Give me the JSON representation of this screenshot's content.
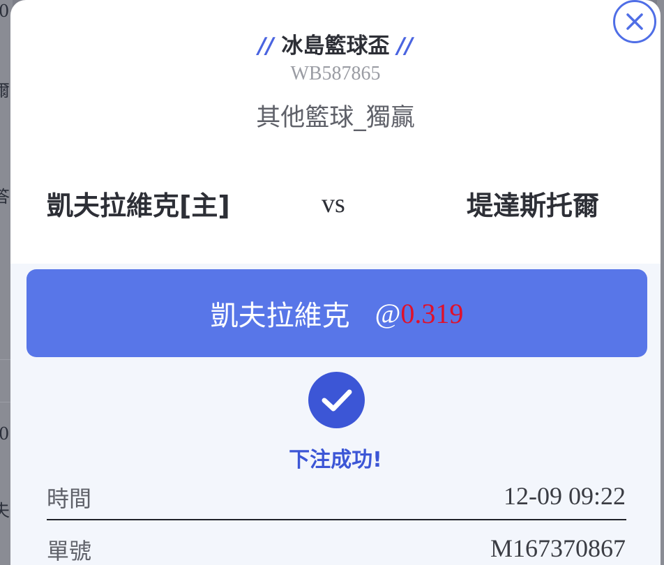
{
  "background": {
    "fragments": [
      "0",
      "爾",
      "答",
      "0",
      "夫"
    ]
  },
  "modal": {
    "league": {
      "prefix": "//",
      "name": "冰島籃球盃",
      "suffix": "//"
    },
    "match_id": "WB587865",
    "market": "其他籃球_獨贏",
    "teams": {
      "home": "凱夫拉維克[主]",
      "vs": "vs",
      "away": "堤達斯托爾"
    },
    "bet": {
      "team": "凱夫拉維克",
      "at": "@",
      "odds": "0.319"
    },
    "status": "下注成功!",
    "details": [
      {
        "label": "時間",
        "value": "12-09 09:22"
      },
      {
        "label": "單號",
        "value": "M167370867"
      }
    ],
    "close_icon": "close-icon",
    "success_icon": "check-circle-icon"
  },
  "colors": {
    "accent": "#5876e8",
    "odds": "#e0102a",
    "success": "#3c56d6"
  }
}
